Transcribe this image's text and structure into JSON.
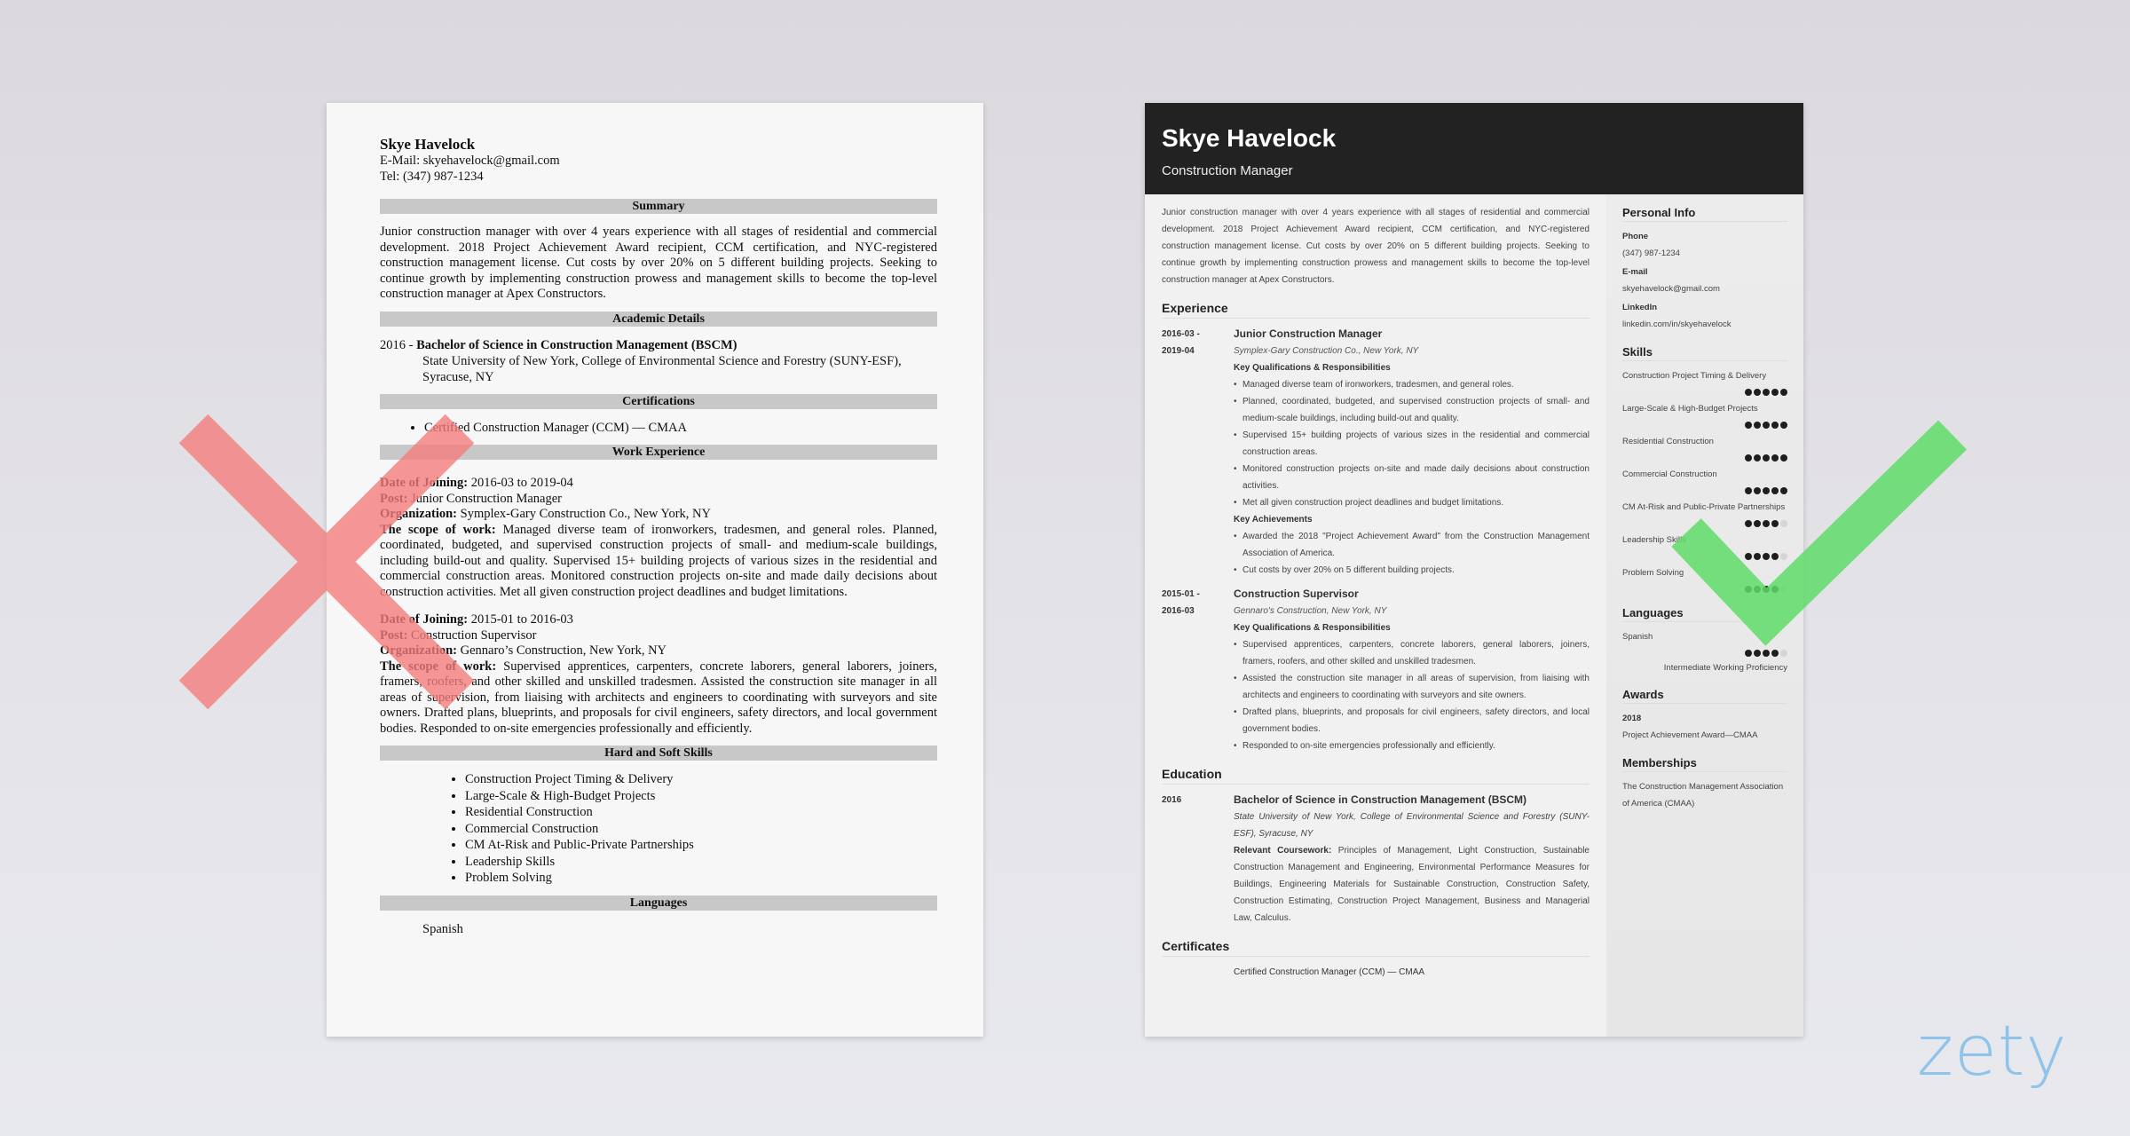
{
  "left_resume": {
    "name": "Skye Havelock",
    "email_line": "E-Mail: skyehavelock@gmail.com",
    "tel_line": "Tel: (347) 987-1234",
    "sections": {
      "summary": "Summary",
      "academic": "Academic Details",
      "certifications": "Certifications",
      "work": "Work Experience",
      "skills": "Hard and Soft Skills",
      "languages": "Languages"
    },
    "summary_text": "Junior construction manager with over 4 years experience with all stages of residential and commercial development. 2018 Project Achievement Award recipient, CCM certification, and NYC-registered construction management license. Cut costs by over 20% on 5 different building projects. Seeking to continue growth by implementing construction prowess and management skills to become the top-level construction manager at Apex Constructors.",
    "education": {
      "year": "2016 - ",
      "degree": "Bachelor of Science in Construction Management (BSCM)",
      "school": "State University of New York, College of Environmental Science and Forestry (SUNY-ESF), Syracuse, NY"
    },
    "certifications": [
      "Certified Construction Manager (CCM) — CMAA"
    ],
    "jobs": [
      {
        "date_label": "Date of Joining:",
        "date": " 2016-03 to 2019-04",
        "post_label": "Post:",
        "post": " Junior Construction Manager",
        "org_label": "Organization:",
        "org": " Symplex-Gary Construction Co., New York, NY",
        "scope_label": "The scope of work:",
        "scope": " Managed diverse team of ironworkers, tradesmen, and general roles. Planned, coordinated, budgeted, and supervised construction projects of small- and medium-scale buildings, including build-out and quality. Supervised 15+ building projects of various sizes in the residential and commercial construction areas. Monitored construction projects on-site and made daily decisions about construction activities. Met all given construction project deadlines and budget limitations."
      },
      {
        "date_label": "Date of Joining:",
        "date": " 2015-01 to 2016-03",
        "post_label": "Post:",
        "post": " Construction Supervisor",
        "org_label": "Organization:",
        "org": " Gennaro’s Construction, New York, NY",
        "scope_label": "The scope of work:",
        "scope": " Supervised apprentices, carpenters, concrete laborers, general laborers, joiners, framers, roofers, and other skilled and unskilled tradesmen. Assisted the construction site manager in all areas of supervision, from liaising with architects and engineers to coordinating with surveyors and site owners. Drafted plans, blueprints, and proposals for civil engineers, safety directors, and local government bodies. Responded to on-site emergencies professionally and efficiently."
      }
    ],
    "skills": [
      "Construction Project Timing & Delivery",
      "Large-Scale & High-Budget Projects",
      "Residential Construction",
      "Commercial Construction",
      "CM At-Risk and Public-Private Partnerships",
      "Leadership Skills",
      "Problem Solving"
    ],
    "languages": [
      "Spanish"
    ]
  },
  "right_resume": {
    "name": "Skye Havelock",
    "title": "Construction Manager",
    "summary": "Junior construction manager with over 4 years experience with all stages of residential and commercial development. 2018 Project Achievement Award recipient, CCM certification, and NYC-registered construction management license. Cut costs by over 20% on 5 different building projects. Seeking to continue growth by implementing construction prowess and management skills to become the top-level construction manager at Apex Constructors.",
    "headings": {
      "experience": "Experience",
      "education": "Education",
      "certificates": "Certificates",
      "personal_info": "Personal Info",
      "skills": "Skills",
      "languages": "Languages",
      "awards": "Awards",
      "memberships": "Memberships"
    },
    "jobs": [
      {
        "date_start": "2016-03 -",
        "date_end": "2019-04",
        "role": "Junior Construction Manager",
        "org": "Symplex-Gary Construction Co., New York, NY",
        "resp_label": "Key Qualifications & Responsibilities",
        "resp": [
          "Managed diverse team of ironworkers, tradesmen, and general roles.",
          "Planned, coordinated, budgeted, and supervised construction projects of small- and medium-scale buildings, including build-out and quality.",
          "Supervised 15+ building projects of various sizes in the residential and commercial construction areas.",
          "Monitored construction projects on-site and made daily decisions about construction activities.",
          "Met all given construction project deadlines and budget limitations."
        ],
        "ach_label": "Key Achievements",
        "ach": [
          "Awarded the 2018 \"Project Achievement Award\" from the Construction Management Association of America.",
          "Cut costs by over 20% on 5 different building projects."
        ]
      },
      {
        "date_start": "2015-01 -",
        "date_end": "2016-03",
        "role": "Construction Supervisor",
        "org": "Gennaro's Construction, New York, NY",
        "resp_label": "Key Qualifications & Responsibilities",
        "resp": [
          "Supervised apprentices, carpenters, concrete laborers, general laborers, joiners, framers, roofers, and other skilled and unskilled tradesmen.",
          "Assisted the construction site manager in all areas of supervision, from liaising with architects and engineers to coordinating with surveyors and site owners.",
          "Drafted plans, blueprints, and proposals for civil engineers, safety directors, and local government bodies.",
          "Responded to on-site emergencies professionally and efficiently."
        ]
      }
    ],
    "education": {
      "year": "2016",
      "degree": "Bachelor of Science in Construction Management (BSCM)",
      "school": "State University of New York, College of Environmental Science and Forestry (SUNY-ESF), Syracuse, NY",
      "coursework_label": "Relevant Coursework:",
      "coursework": " Principles of Management, Light Construction, Sustainable Construction Management and Engineering, Environmental Performance Measures for Buildings, Engineering Materials for Sustainable Construction, Construction Safety, Construction Estimating, Construction Project Management, Business and Managerial Law, Calculus."
    },
    "certificates": [
      "Certified Construction Manager (CCM) — CMAA"
    ],
    "personal_info": {
      "phone_label": "Phone",
      "phone": "(347) 987-1234",
      "email_label": "E-mail",
      "email": "skyehavelock@gmail.com",
      "linkedin_label": "LinkedIn",
      "linkedin": "linkedin.com/in/skyehavelock"
    },
    "skills": [
      {
        "name": "Construction Project Timing & Delivery",
        "level": 5,
        "max": 5
      },
      {
        "name": "Large-Scale & High-Budget Projects",
        "level": 5,
        "max": 5
      },
      {
        "name": "Residential Construction",
        "level": 5,
        "max": 5
      },
      {
        "name": "Commercial Construction",
        "level": 5,
        "max": 5
      },
      {
        "name": "CM At-Risk and Public-Private Partnerships",
        "level": 4,
        "max": 5
      },
      {
        "name": "Leadership Skills",
        "level": 4,
        "max": 5
      },
      {
        "name": "Problem Solving",
        "level": 4,
        "max": 5
      }
    ],
    "languages": [
      {
        "name": "Spanish",
        "level": 4,
        "max": 5,
        "proficiency": "Intermediate Working Proficiency"
      }
    ],
    "awards": [
      {
        "year": "2018",
        "name": "Project Achievement Award—CMAA"
      }
    ],
    "memberships": [
      "The Construction Management Association of America (CMAA)"
    ]
  },
  "marks": {
    "bad_mark": "red-x",
    "good_mark": "green-check",
    "bad_color": "#f47c7c",
    "good_color": "#5fdc6a"
  },
  "brand": {
    "logo_text": "zety",
    "logo_color": "#8fc3ea"
  }
}
